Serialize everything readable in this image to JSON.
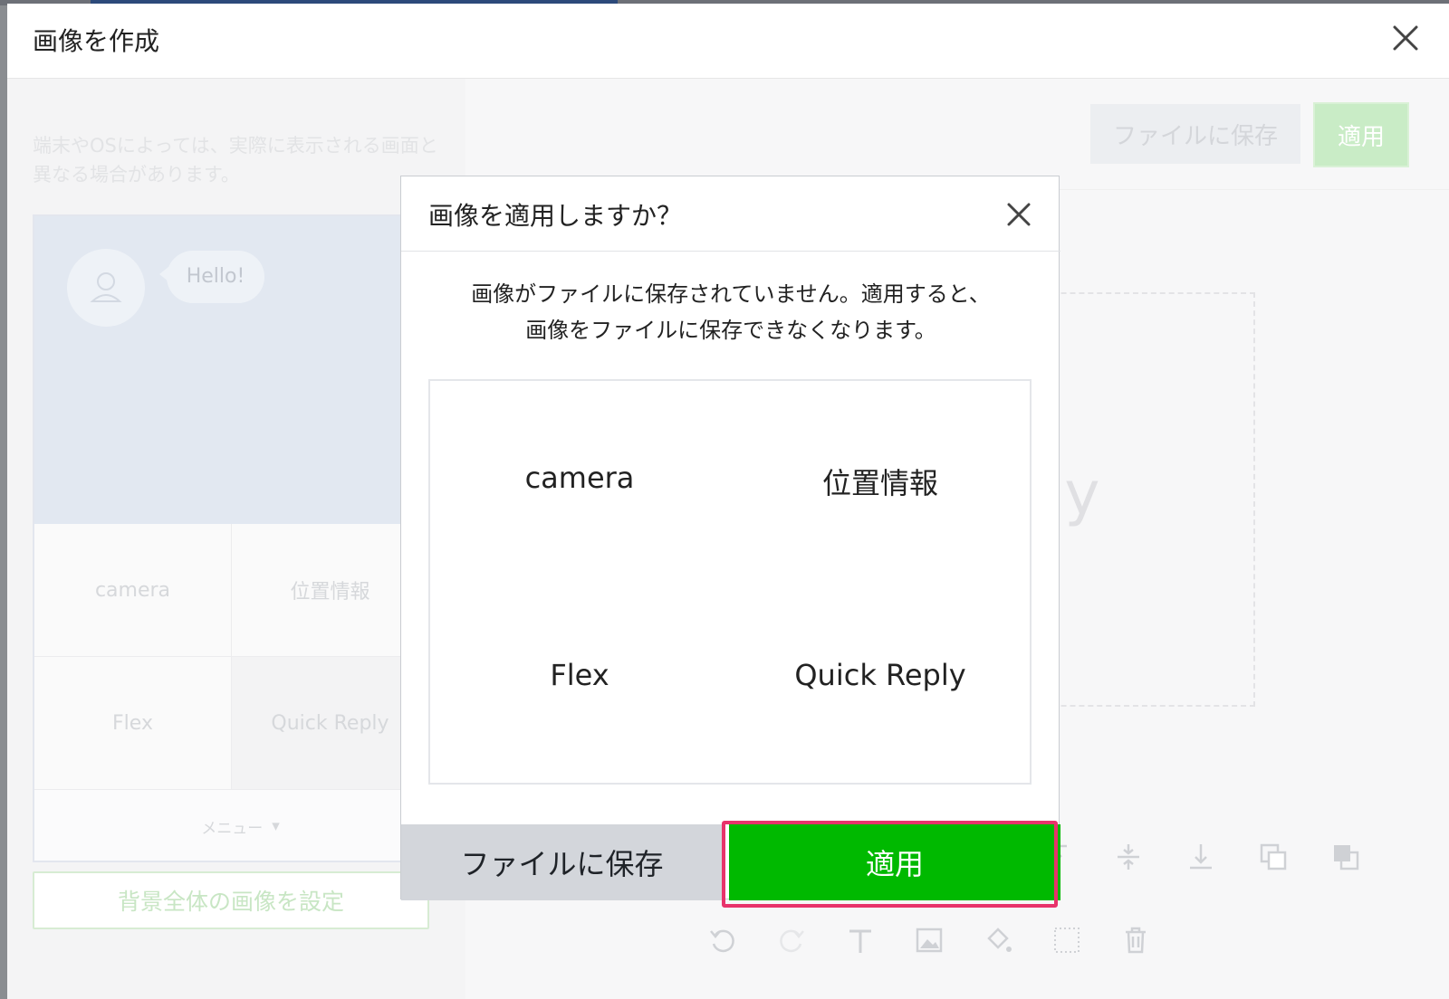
{
  "window": {
    "title": "画像を作成",
    "close_icon": "close-icon"
  },
  "left_panel": {
    "notice": "端末やOSによっては、実際に表示される画面と異なる場合があります。",
    "chat_bubble": "Hello!",
    "grid": [
      "camera",
      "位置情報",
      "Flex",
      "Quick Reply"
    ],
    "menu_label": "メニュー",
    "menu_caret": "▾",
    "background_button": "背景全体の画像を設定"
  },
  "right_panel": {
    "save_button": "ファイルに保存",
    "apply_button": "適用",
    "canvas_text": "Quick Reply"
  },
  "dialog": {
    "title": "画像を適用しますか？",
    "message_line1": "画像がファイルに保存されていません。適用すると、",
    "message_line2": "画像をファイルに保存できなくなります。",
    "preview": [
      "camera",
      "位置情報",
      "Flex",
      "Quick Reply"
    ],
    "save_button": "ファイルに保存",
    "apply_button": "適用"
  },
  "colors": {
    "primary_green": "#00b900",
    "highlight": "#e8336b"
  }
}
